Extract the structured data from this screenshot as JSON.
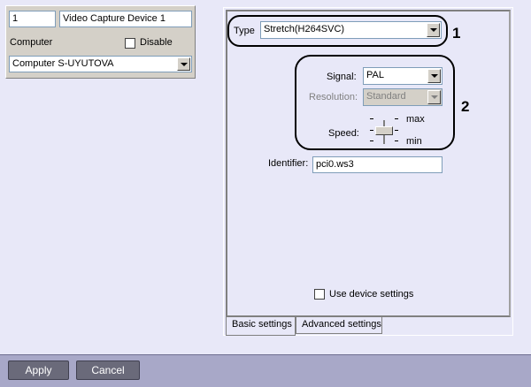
{
  "device": {
    "id": "1",
    "name": "Video Capture Device 1",
    "computer_label": "Computer",
    "disable_label": "Disable",
    "disable_checked": false,
    "computer_value": "Computer S-UYUTOVA"
  },
  "settings": {
    "type_label": "Type",
    "type_value": "Stretch(H264SVC)",
    "signal_label": "Signal:",
    "signal_value": "PAL",
    "resolution_label": "Resolution:",
    "resolution_value": "Standard",
    "speed_label": "Speed:",
    "speed_max": "max",
    "speed_min": "min",
    "identifier_label": "Identifier:",
    "identifier_value": "pci0.ws3",
    "use_device_settings_label": "Use device settings",
    "use_device_settings_checked": false
  },
  "tabs": [
    {
      "label": "Basic settings",
      "active": true
    },
    {
      "label": "Advanced settings",
      "active": false
    }
  ],
  "callouts": [
    "1",
    "2"
  ],
  "buttons": {
    "apply": "Apply",
    "cancel": "Cancel"
  }
}
